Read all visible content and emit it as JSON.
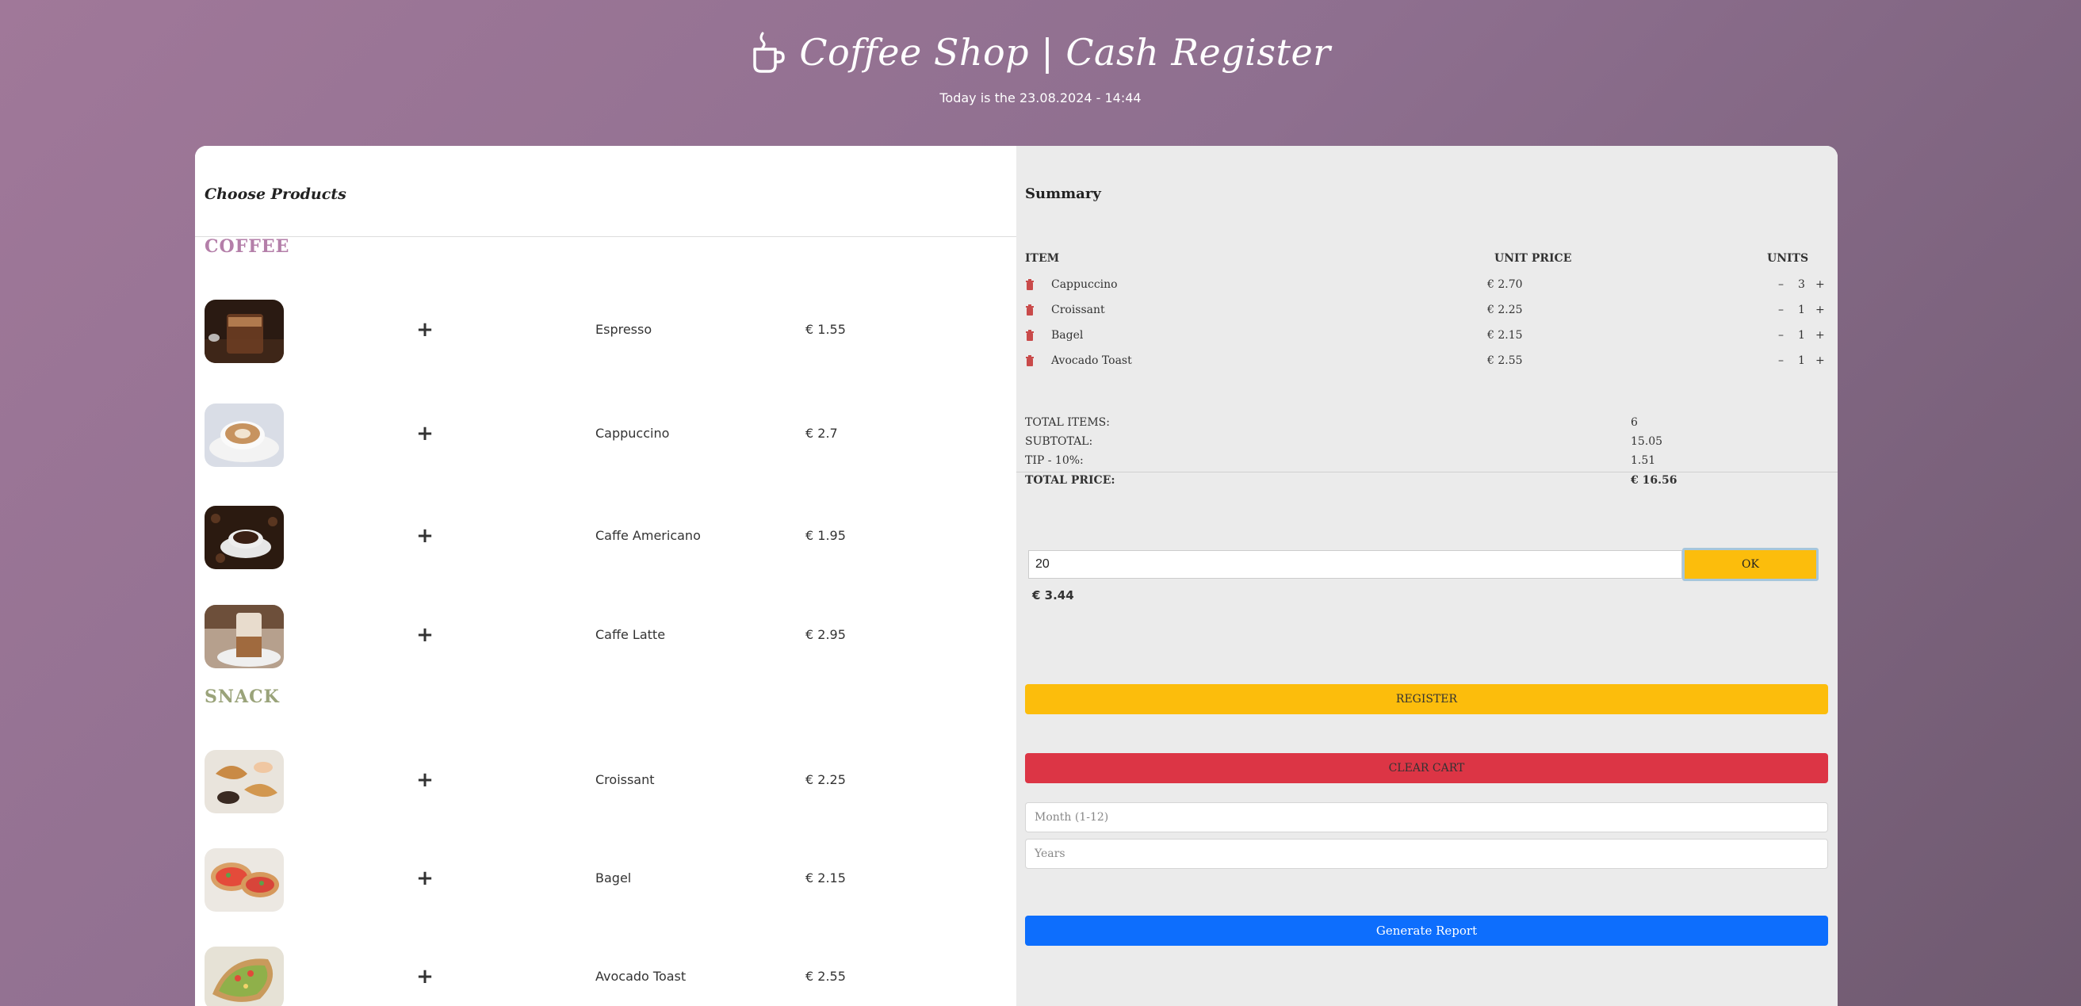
{
  "header": {
    "title": "Coffee Shop | Cash Register",
    "date_line": "Today is the 23.08.2024 - 14:44"
  },
  "left": {
    "section_title": "Choose Products",
    "categories": {
      "coffee": "COFFEE",
      "snack": "SNACK"
    },
    "add_label": "+",
    "products": [
      {
        "name": "Espresso",
        "price": "€ 1.55",
        "category": "coffee"
      },
      {
        "name": "Cappuccino",
        "price": "€ 2.7",
        "category": "coffee"
      },
      {
        "name": "Caffe Americano",
        "price": "€ 1.95",
        "category": "coffee"
      },
      {
        "name": "Caffe Latte",
        "price": "€ 2.95",
        "category": "coffee"
      },
      {
        "name": "Croissant",
        "price": "€ 2.25",
        "category": "snack"
      },
      {
        "name": "Bagel",
        "price": "€ 2.15",
        "category": "snack"
      },
      {
        "name": "Avocado Toast",
        "price": "€ 2.55",
        "category": "snack"
      }
    ]
  },
  "summary": {
    "title": "Summary",
    "columns": {
      "item": "ITEM",
      "unit_price": "UNIT PRICE",
      "units": "UNITS"
    },
    "minus": "–",
    "plus": "+",
    "cart": [
      {
        "name": "Cappuccino",
        "price": "€ 2.70",
        "qty": "3"
      },
      {
        "name": "Croissant",
        "price": "€ 2.25",
        "qty": "1"
      },
      {
        "name": "Bagel",
        "price": "€ 2.15",
        "qty": "1"
      },
      {
        "name": "Avocado Toast",
        "price": "€ 2.55",
        "qty": "1"
      }
    ],
    "totals": {
      "items_label": "TOTAL ITEMS:",
      "items_value": "6",
      "subtotal_label": "SUBTOTAL:",
      "subtotal_value": "15.05",
      "tip_label": "TIP - 10%:",
      "tip_value": "1.51",
      "total_label": "TOTAL PRICE:",
      "total_value": "€ 16.56"
    },
    "payment": {
      "input_value": "20",
      "ok_label": "OK",
      "change": "€ 3.44"
    },
    "register_label": "REGISTER",
    "clear_label": "CLEAR CART",
    "month_placeholder": "Month (1-12)",
    "years_placeholder": "Years",
    "report_label": "Generate Report"
  },
  "colors": {
    "accent_yellow": "#fcbd0c",
    "danger_red": "#dc3545",
    "primary_blue": "#0d6efd",
    "coffee_category": "#b47fa9",
    "snack_category": "#9aa37a"
  }
}
